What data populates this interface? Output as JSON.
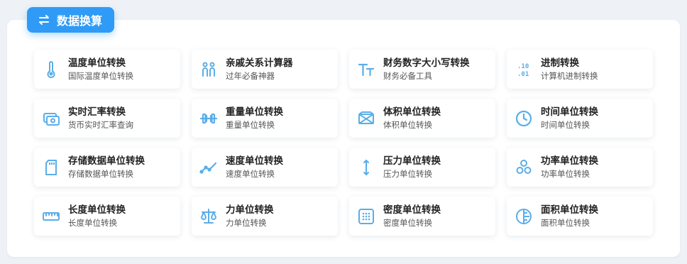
{
  "header": {
    "title": "数据换算",
    "icon": "swap-icon"
  },
  "accent": "#2f9bf6",
  "icon_color": "#5aaee8",
  "cards": [
    {
      "title": "温度单位转换",
      "sub": "国际温度单位转换",
      "icon": "thermometer-icon"
    },
    {
      "title": "亲戚关系计算器",
      "sub": "过年必备神器",
      "icon": "people-icon"
    },
    {
      "title": "财务数字大小写转换",
      "sub": "财务必备工具",
      "icon": "text-size-icon"
    },
    {
      "title": "进制转换",
      "sub": "计算机进制转换",
      "icon": "binary-icon"
    },
    {
      "title": "实时汇率转换",
      "sub": "货币实时汇率查询",
      "icon": "money-icon"
    },
    {
      "title": "重量单位转换",
      "sub": "重量单位转换",
      "icon": "dumbbell-icon"
    },
    {
      "title": "体积单位转换",
      "sub": "体积单位转换",
      "icon": "box-icon"
    },
    {
      "title": "时间单位转换",
      "sub": "时间单位转换",
      "icon": "clock-icon"
    },
    {
      "title": "存储数据单位转换",
      "sub": "存储数据单位转换",
      "icon": "sd-card-icon"
    },
    {
      "title": "速度单位转换",
      "sub": "速度单位转换",
      "icon": "trend-line-icon"
    },
    {
      "title": "压力单位转换",
      "sub": "压力单位转换",
      "icon": "vertical-arrows-icon"
    },
    {
      "title": "功率单位转换",
      "sub": "功率单位转换",
      "icon": "fan-icon"
    },
    {
      "title": "长度单位转换",
      "sub": "长度单位转换",
      "icon": "ruler-icon"
    },
    {
      "title": "力单位转换",
      "sub": "力单位转换",
      "icon": "scale-icon"
    },
    {
      "title": "密度单位转换",
      "sub": "密度单位转换",
      "icon": "dotted-square-icon"
    },
    {
      "title": "面积单位转换",
      "sub": "面积单位转换",
      "icon": "area-circle-icon"
    }
  ]
}
